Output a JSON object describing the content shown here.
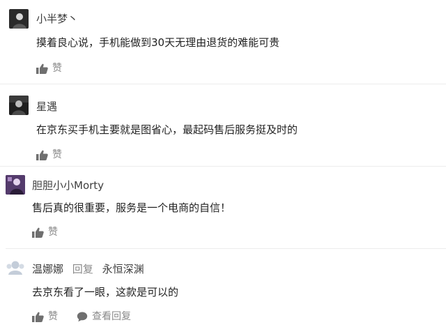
{
  "comments": [
    {
      "username": "小半梦丶",
      "text": "摸着良心说，手机能做到30天无理由退货的难能可贵",
      "like_label": "赞",
      "avatar_icon": "dark-user-avatar"
    },
    {
      "username": "星遇",
      "text": "在京东买手机主要就是图省心，最起码售后服务挺及时的",
      "like_label": "赞",
      "avatar_icon": "dark-user-avatar"
    },
    {
      "username": "胆胆小小Morty",
      "text": "售后真的很重要，服务是一个电商的自信！",
      "like_label": "赞",
      "avatar_icon": "purple-user-avatar"
    },
    {
      "username": "温娜娜",
      "reply_word": "回复",
      "reply_to": "永恒深渊",
      "text": "去京东看了一眼，这款是可以的",
      "like_label": "赞",
      "view_reply_label": "查看回复",
      "avatar_icon": "default-user-avatar"
    }
  ],
  "colors": {
    "text": "#222222",
    "meta": "#8a8a8a",
    "divider": "#ececec"
  }
}
